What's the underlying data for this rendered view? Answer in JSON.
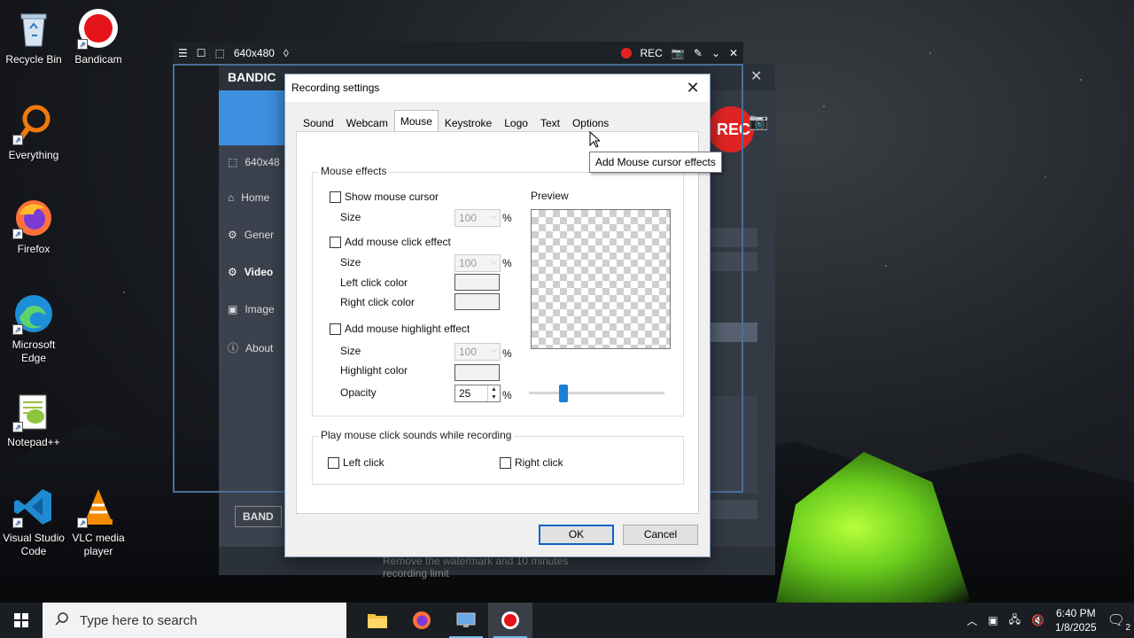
{
  "desktop": {
    "icons": [
      {
        "label": "Recycle Bin"
      },
      {
        "label": "Bandicam"
      },
      {
        "label": "Everything"
      },
      {
        "label": "Firefox"
      },
      {
        "label": "Microsoft Edge"
      },
      {
        "label": "Notepad++"
      },
      {
        "label": "Visual Studio Code"
      },
      {
        "label": "VLC media player"
      }
    ]
  },
  "capture_bar": {
    "resolution": "640x480",
    "rec_label": "REC"
  },
  "bandicam": {
    "logo": "BANDIC",
    "size_label": "640x48",
    "nav": [
      {
        "label": "Home"
      },
      {
        "label": "Gener"
      },
      {
        "label": "Video"
      },
      {
        "label": "Image"
      },
      {
        "label": "About"
      }
    ],
    "rec_button": "REC",
    "bottom_brand": "BAND",
    "watermark_notice": "Remove the watermark and 10 minutes recording limit"
  },
  "dialog": {
    "title": "Recording settings",
    "tabs": [
      {
        "label": "Sound"
      },
      {
        "label": "Webcam"
      },
      {
        "label": "Mouse"
      },
      {
        "label": "Keystroke"
      },
      {
        "label": "Logo"
      },
      {
        "label": "Text"
      },
      {
        "label": "Options"
      }
    ],
    "active_tab": "Mouse",
    "mouse_effects": {
      "group_title": "Mouse effects",
      "show_cursor": "Show mouse cursor",
      "size_label": "Size",
      "size_value_1": "100",
      "click_effect": "Add mouse click effect",
      "size_value_2": "100",
      "left_click_color": "Left click color",
      "right_click_color": "Right click color",
      "highlight_effect": "Add mouse highlight effect",
      "size_value_3": "100",
      "highlight_color": "Highlight color",
      "opacity_label": "Opacity",
      "opacity_value": "25",
      "percent": "%",
      "preview_label": "Preview"
    },
    "click_sounds": {
      "group_title": "Play mouse click sounds while recording",
      "left_click": "Left click",
      "right_click": "Right click"
    },
    "ok_label": "OK",
    "cancel_label": "Cancel",
    "tooltip": "Add Mouse cursor effects"
  },
  "taskbar": {
    "search_placeholder": "Type here to search",
    "time": "6:40 PM",
    "date": "1/8/2025",
    "notification_count": "2"
  },
  "colors": {
    "accent": "#0a64c8",
    "bandicam_blue": "#3d8fe0",
    "rec_red": "#e02424"
  }
}
